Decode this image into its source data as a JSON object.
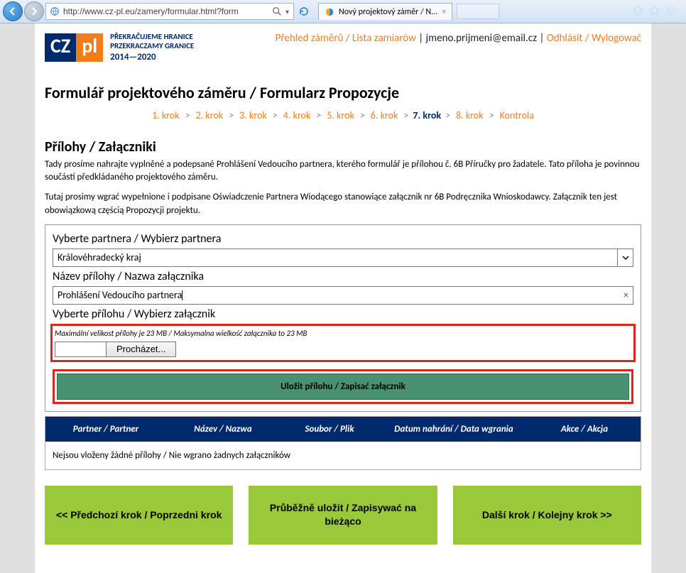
{
  "browser": {
    "url": "http://www.cz-pl.eu/zamery/formular.html?form",
    "tab_title": "Nový projektový záměr / N..."
  },
  "logo": {
    "cz": "CZ",
    "pl": "pl",
    "line1": "PŘEKRAČUJEME HRANICE",
    "line2": "PRZEKRACZAMY GRANICE",
    "years": "2014—2020"
  },
  "header_links": {
    "overview": "Přehled záměrů / Lista zamiarów",
    "sep1": " | ",
    "email": "jmeno.prijmeni@email.cz",
    "sep2": " | ",
    "logout": "Odhlásit / Wylogować"
  },
  "page_title": "Formulář projektového záměru / Formularz Propozycje",
  "steps": {
    "items": [
      "1. krok",
      "2. krok",
      "3. krok",
      "4. krok",
      "5. krok",
      "6. krok",
      "7. krok",
      "8. krok",
      "Kontrola"
    ],
    "current_index": 6
  },
  "section_title": "Přílohy / Załączniki",
  "intro_p1": "Tady prosíme nahrajte vyplněné a podepsané Prohlášení Vedoucího partnera, kterého formulář je přílohou č. 6B Příručky pro žadatele. Tato příloha je povinnou součástí předkládaného projektového záměru.",
  "intro_p2": "Tutaj prosimy wgrać wypełnione i podpisane Oświadczenie Partnera Wiodącego stanowiące załącznik nr 6B Podręcznika Wnioskodawcy. Załącznik ten jest obowiązkową częścią Propozycji projektu.",
  "form": {
    "partner_label": "Vyberte partnera / Wybierz partnera",
    "partner_value": "Královéhradecký kraj",
    "name_label": "Název přílohy / Nazwa załącznika",
    "name_value": "Prohlášení Vedoucího partnera",
    "file_label": "Vyberte přílohu / Wybierz załącznik",
    "file_hint": "Maximální velikost přílohy je 23 MB / Maksymalna wielkość załącznika to 23 MB",
    "browse_label": "Procházet...",
    "upload_label": "Uložit přílohu / Zapisać załącznik"
  },
  "table": {
    "headers": {
      "partner": "Partner / Partner",
      "name": "Název / Nazwa",
      "file": "Soubor / Plik",
      "date": "Datum nahrání / Data wgrania",
      "action": "Akce / Akcja"
    },
    "empty": "Nejsou vloženy žádné přílohy / Nie wgrano żadnych załączników"
  },
  "nav_buttons": {
    "prev": "<< Předchozí krok / Poprzedni krok",
    "save": "Průběžně uložit / Zapisywać na bieżąco",
    "next": "Další krok / Kolejny krok >>"
  }
}
